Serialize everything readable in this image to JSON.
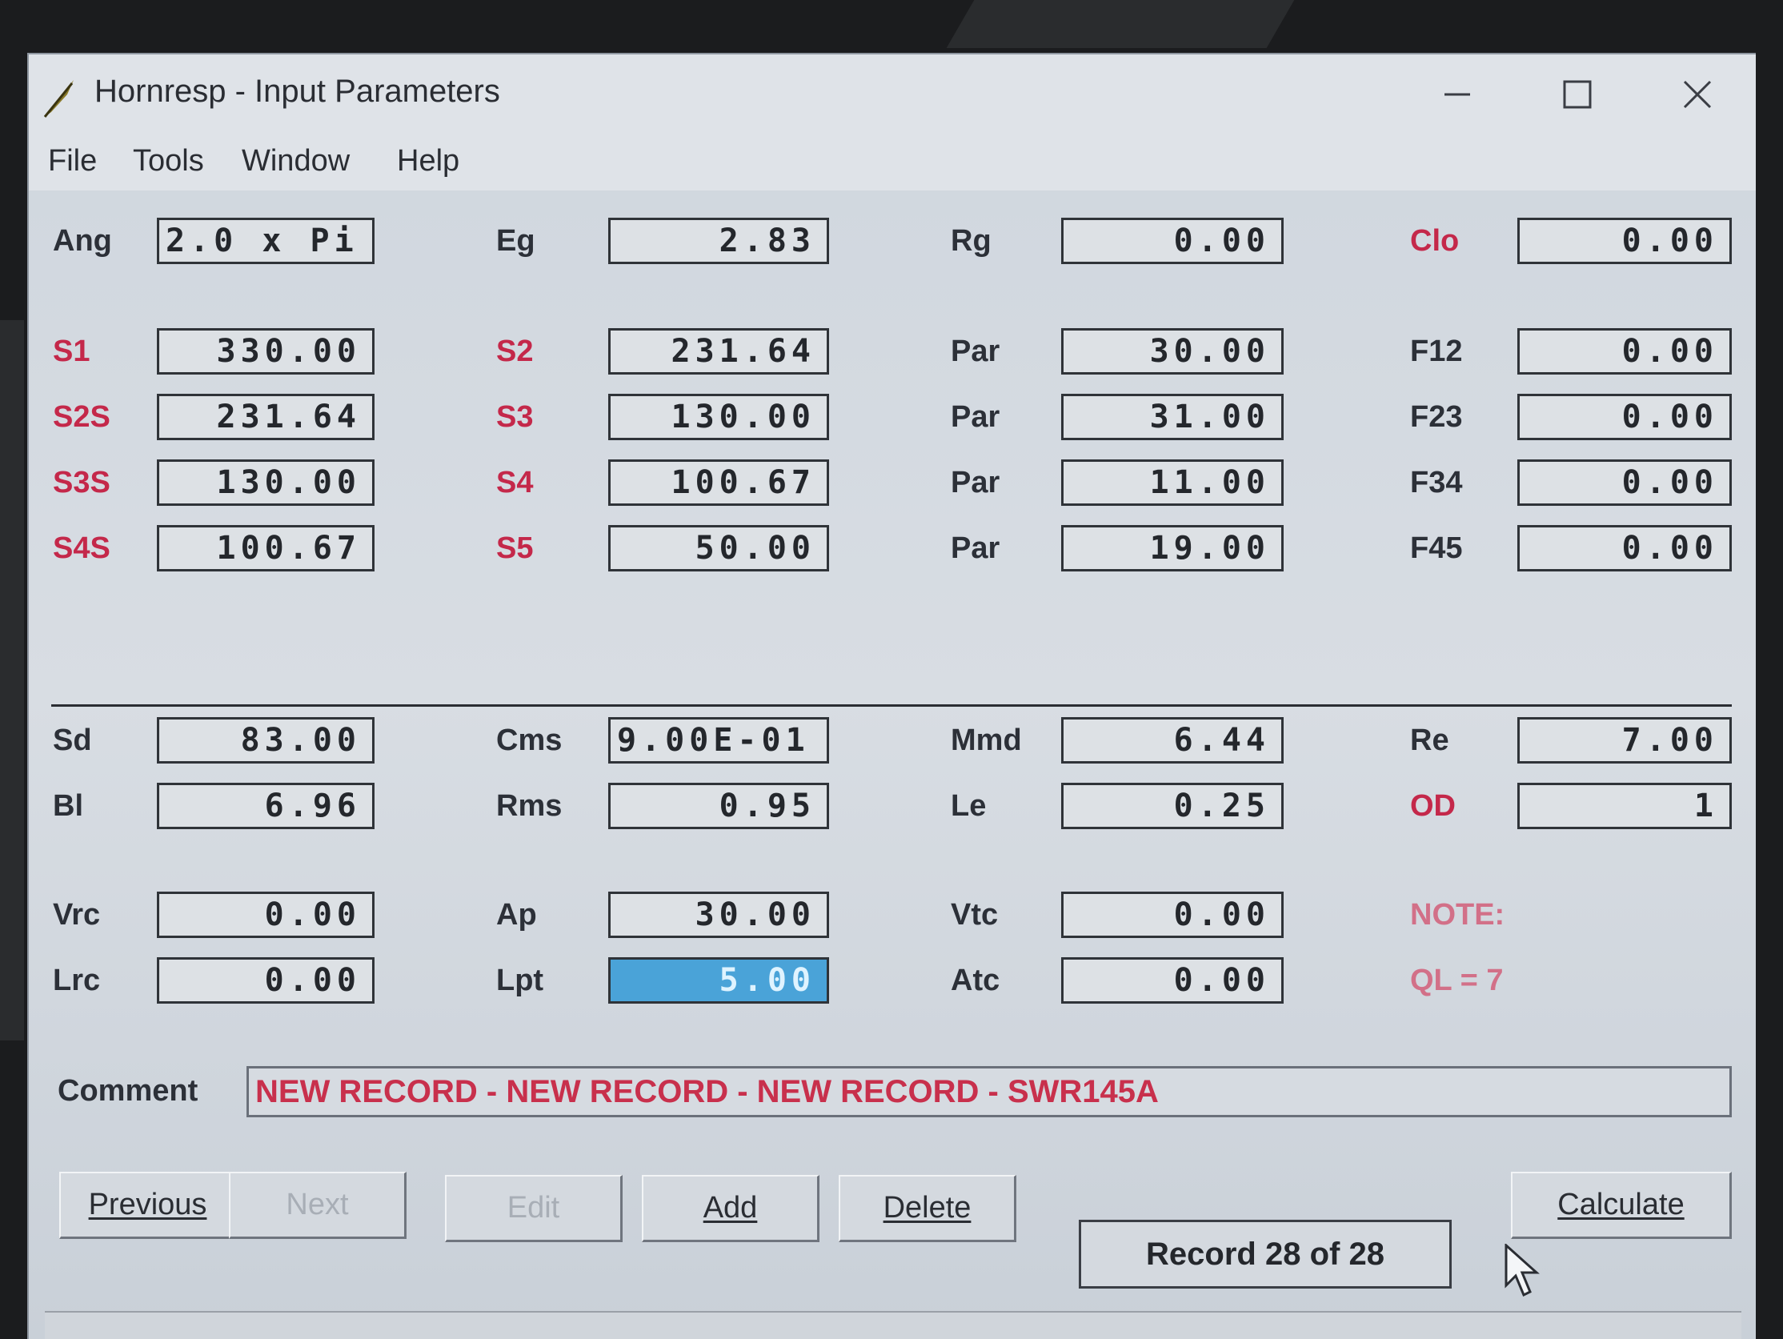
{
  "window": {
    "title": "Hornresp - Input Parameters",
    "controls": {
      "minimize": "minimize-icon",
      "maximize": "maximize-icon",
      "close": "close-icon"
    }
  },
  "menu": [
    "File",
    "Tools",
    "Window",
    "Help"
  ],
  "top_params": {
    "ang": {
      "label": "Ang",
      "value": "2.0 x Pi"
    },
    "eg": {
      "label": "Eg",
      "value": "2.83"
    },
    "rg": {
      "label": "Rg",
      "value": "0.00"
    },
    "clo": {
      "label": "Clo",
      "value": "0.00"
    }
  },
  "horn_rows": [
    {
      "a_label": "S1",
      "a_value": "330.00",
      "b_label": "S2",
      "b_value": "231.64",
      "c_label": "Par",
      "c_value": "30.00",
      "d_label": "F12",
      "d_value": "0.00"
    },
    {
      "a_label": "S2S",
      "a_value": "231.64",
      "b_label": "S3",
      "b_value": "130.00",
      "c_label": "Par",
      "c_value": "31.00",
      "d_label": "F23",
      "d_value": "0.00"
    },
    {
      "a_label": "S3S",
      "a_value": "130.00",
      "b_label": "S4",
      "b_value": "100.67",
      "c_label": "Par",
      "c_value": "11.00",
      "d_label": "F34",
      "d_value": "0.00"
    },
    {
      "a_label": "S4S",
      "a_value": "100.67",
      "b_label": "S5",
      "b_value": "50.00",
      "c_label": "Par",
      "c_value": "19.00",
      "d_label": "F45",
      "d_value": "0.00"
    }
  ],
  "driver": {
    "sd": {
      "label": "Sd",
      "value": "83.00"
    },
    "cms": {
      "label": "Cms",
      "value": "9.00E-01"
    },
    "mmd": {
      "label": "Mmd",
      "value": "6.44"
    },
    "re": {
      "label": "Re",
      "value": "7.00"
    },
    "bl": {
      "label": "Bl",
      "value": "6.96"
    },
    "rms": {
      "label": "Rms",
      "value": "0.95"
    },
    "le": {
      "label": "Le",
      "value": "0.25"
    },
    "od": {
      "label": "OD",
      "value": "1"
    }
  },
  "chambers": {
    "vrc": {
      "label": "Vrc",
      "value": "0.00"
    },
    "ap": {
      "label": "Ap",
      "value": "30.00"
    },
    "vtc": {
      "label": "Vtc",
      "value": "0.00"
    },
    "lrc": {
      "label": "Lrc",
      "value": "0.00"
    },
    "lpt": {
      "label": "Lpt",
      "value": "5.00"
    },
    "atc": {
      "label": "Atc",
      "value": "0.00"
    }
  },
  "note": {
    "title": "NOTE:",
    "text": "QL = 7"
  },
  "comment": {
    "label": "Comment",
    "value": "NEW RECORD - NEW RECORD - NEW RECORD - SWR145A"
  },
  "buttons": {
    "previous": "Previous",
    "next": "Next",
    "edit": "Edit",
    "add": "Add",
    "delete": "Delete",
    "calculate": "Calculate"
  },
  "record_status": "Record 28 of 28"
}
